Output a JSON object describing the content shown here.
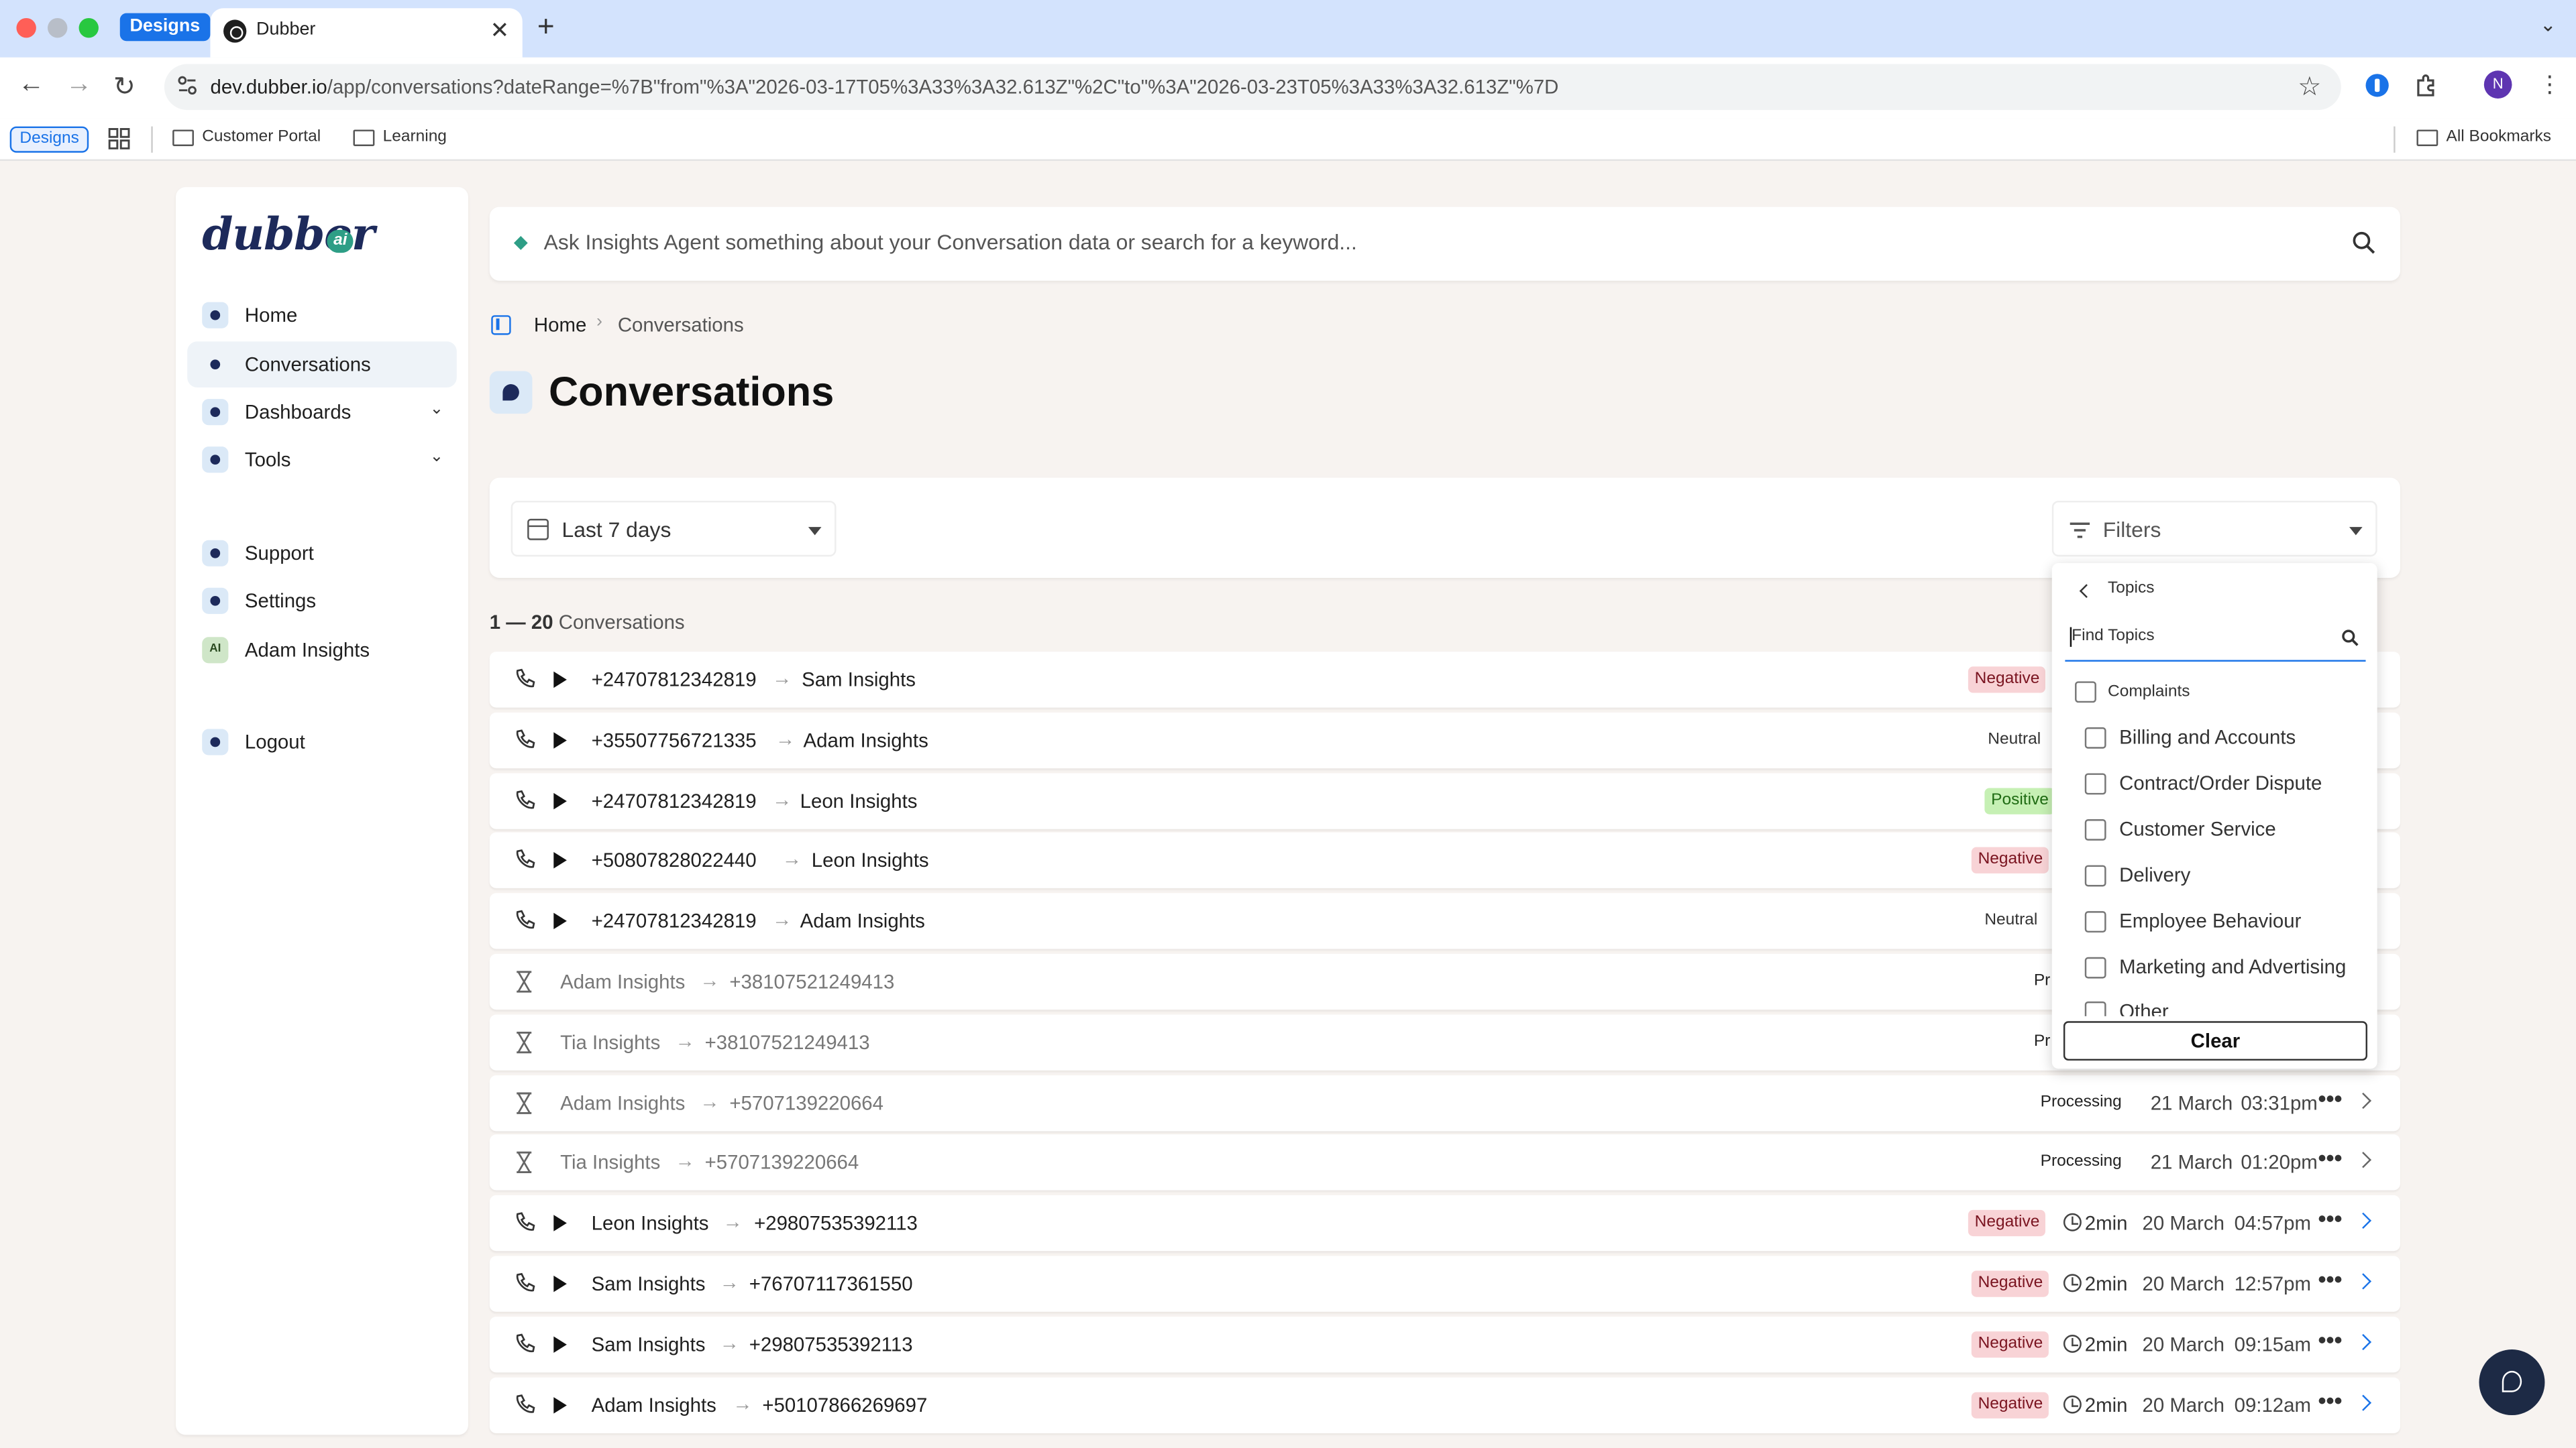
{
  "browser": {
    "tab_group": "Designs",
    "tab_title": "Dubber",
    "url_host": "dev.dubber.io",
    "url_path": "/app/conversations?dateRange=%7B\"from\"%3A\"2026-03-17T05%3A33%3A32.613Z\"%2C\"to\"%3A\"2026-03-23T05%3A33%3A32.613Z\"%7D",
    "profile_initial": "N",
    "bookmarks": {
      "group_label": "Designs",
      "items": [
        "Customer Portal",
        "Learning"
      ],
      "all_bookmarks": "All Bookmarks"
    }
  },
  "sidebar": {
    "logo_text": "dubber",
    "logo_badge": "ai",
    "items": [
      {
        "label": "Home",
        "icon": "home-icon"
      },
      {
        "label": "Conversations",
        "icon": "conversations-icon"
      },
      {
        "label": "Dashboards",
        "icon": "dashboards-icon"
      },
      {
        "label": "Tools",
        "icon": "tools-icon"
      },
      {
        "label": "Support",
        "icon": "support-icon"
      },
      {
        "label": "Settings",
        "icon": "settings-icon"
      },
      {
        "label": "Adam Insights",
        "icon_text": "AI"
      },
      {
        "label": "Logout",
        "icon": "logout-icon"
      }
    ]
  },
  "search": {
    "placeholder": "Ask Insights Agent something about your Conversation data or search for a keyword..."
  },
  "breadcrumb": {
    "home": "Home",
    "current": "Conversations"
  },
  "page_title": "Conversations",
  "filters": {
    "date_range": "Last 7 days",
    "filters_label": "Filters"
  },
  "count": {
    "range": "1 — 20",
    "label": "Conversations"
  },
  "rows": [
    {
      "type": "call",
      "from": "+24707812342819",
      "to": "Sam Insights",
      "sentiment": "Negative"
    },
    {
      "type": "call",
      "from": "+35507756721335",
      "to": "Adam Insights",
      "sentiment": "Neutral"
    },
    {
      "type": "call",
      "from": "+24707812342819",
      "to": "Leon Insights",
      "sentiment": "Positive"
    },
    {
      "type": "call",
      "from": "+50807828022440",
      "to": "Leon Insights",
      "sentiment": "Negative"
    },
    {
      "type": "call",
      "from": "+24707812342819",
      "to": "Adam Insights",
      "sentiment": "Neutral"
    },
    {
      "type": "processing",
      "from": "Adam Insights",
      "to": "+38107521249413",
      "sentiment": "Pr"
    },
    {
      "type": "processing",
      "from": "Tia Insights",
      "to": "+38107521249413",
      "sentiment": "Pr"
    },
    {
      "type": "processing",
      "from": "Adam Insights",
      "to": "+5707139220664",
      "sentiment": "Processing",
      "date": "21 March",
      "time": "03:31pm"
    },
    {
      "type": "processing",
      "from": "Tia Insights",
      "to": "+5707139220664",
      "sentiment": "Processing",
      "date": "21 March",
      "time": "01:20pm"
    },
    {
      "type": "call",
      "from": "Leon Insights",
      "to": "+29807535392113",
      "sentiment": "Negative",
      "duration": "2min",
      "date": "20 March",
      "time": "04:57pm"
    },
    {
      "type": "call",
      "from": "Sam Insights",
      "to": "+76707117361550",
      "sentiment": "Negative",
      "duration": "2min",
      "date": "20 March",
      "time": "12:57pm"
    },
    {
      "type": "call",
      "from": "Sam Insights",
      "to": "+29807535392113",
      "sentiment": "Negative",
      "duration": "2min",
      "date": "20 March",
      "time": "09:15am"
    },
    {
      "type": "call",
      "from": "Adam Insights",
      "to": "+50107866269697",
      "sentiment": "Negative",
      "duration": "2min",
      "date": "20 March",
      "time": "09:12am"
    }
  ],
  "topics": {
    "title": "Topics",
    "search_placeholder": "Find Topics",
    "parent": "Complaints",
    "items": [
      "Billing and Accounts",
      "Contract/Order Dispute",
      "Customer Service",
      "Delivery",
      "Employee Behaviour",
      "Marketing and Advertising",
      "Other"
    ],
    "clear_label": "Clear"
  },
  "colors": {
    "accent": "#1a73e8",
    "brand_navy": "#1d2a5b",
    "negative_bg": "#f8d3d6",
    "positive_bg": "#c6f0b4"
  }
}
